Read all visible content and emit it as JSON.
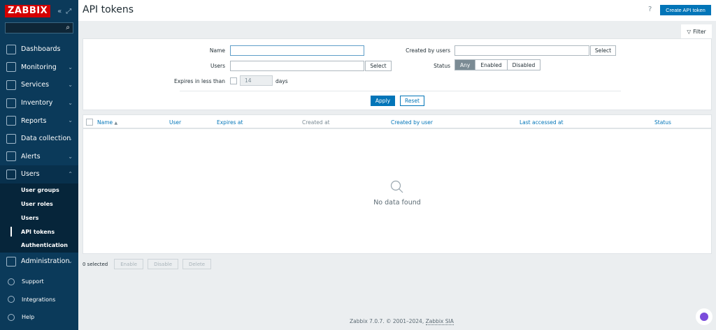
{
  "app": {
    "logo": "ZABBIX",
    "title": "API tokens",
    "help_label": "?",
    "create_label": "Create API token"
  },
  "sidebar": {
    "collapse_icon": "double-chevron-left-icon",
    "kiosk_icon": "expand-icon",
    "search_placeholder": "",
    "items": [
      {
        "label": "Dashboards",
        "icon": "dashboard-icon"
      },
      {
        "label": "Monitoring",
        "icon": "monitor-icon"
      },
      {
        "label": "Services",
        "icon": "services-icon"
      },
      {
        "label": "Inventory",
        "icon": "inventory-icon"
      },
      {
        "label": "Reports",
        "icon": "reports-icon"
      },
      {
        "label": "Data collection",
        "icon": "data-collection-icon"
      },
      {
        "label": "Alerts",
        "icon": "bell-icon"
      },
      {
        "label": "Users",
        "icon": "users-icon"
      }
    ],
    "user_sub": [
      {
        "label": "User groups"
      },
      {
        "label": "User roles"
      },
      {
        "label": "Users"
      },
      {
        "label": "API tokens"
      },
      {
        "label": "Authentication"
      }
    ],
    "admin": {
      "label": "Administration",
      "icon": "gear-icon"
    },
    "bottom": [
      {
        "label": "Support",
        "icon": "headset-icon"
      },
      {
        "label": "Integrations",
        "icon": "integrations-icon"
      },
      {
        "label": "Help",
        "icon": "help-icon"
      }
    ]
  },
  "filter": {
    "tab_label": "Filter",
    "name_label": "Name",
    "name_value": "",
    "users_label": "Users",
    "users_value": "",
    "select_label": "Select",
    "expires_label": "Expires in less than",
    "days_value": "14",
    "days_label": "days",
    "created_by_label": "Created by users",
    "created_by_value": "",
    "status_label": "Status",
    "status_options": [
      "Any",
      "Enabled",
      "Disabled"
    ],
    "status_selected": "Any",
    "apply_label": "Apply",
    "reset_label": "Reset"
  },
  "table": {
    "columns": [
      "Name",
      "User",
      "Expires at",
      "Created at",
      "Created by user",
      "Last accessed at",
      "Status"
    ],
    "sort_indicator": "▲",
    "empty_text": "No data found"
  },
  "actions": {
    "selected": "0 selected",
    "enable": "Enable",
    "disable": "Disable",
    "delete": "Delete"
  },
  "footer": {
    "copyright": "Zabbix 7.0.7. © 2001–2024, ",
    "company": "Zabbix SIA"
  },
  "colors": {
    "sidebar": "#0b3a5a",
    "accent": "#0275b8",
    "logo": "#d40000"
  }
}
